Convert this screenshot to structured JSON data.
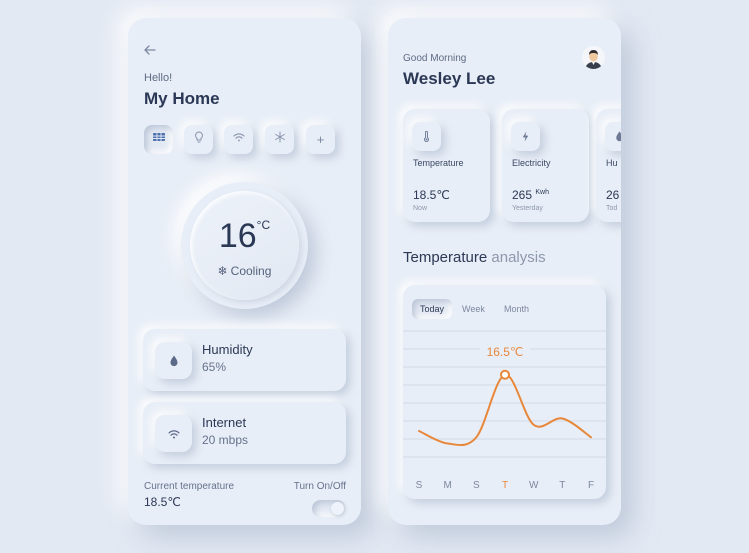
{
  "colors": {
    "background": "#e3e9f3",
    "accent": "#e8873a",
    "text_dark": "#2b3855",
    "text_muted": "#66738d"
  },
  "left": {
    "greeting": "Hello!",
    "title": "My Home",
    "device_buttons": [
      {
        "icon": "heater-icon"
      },
      {
        "icon": "lightbulb-icon"
      },
      {
        "icon": "wifi-icon"
      },
      {
        "icon": "fan-icon"
      },
      {
        "icon": "plus-icon",
        "label": "+"
      }
    ],
    "dial": {
      "temperature": "16",
      "unit": "°C",
      "mode": "Cooling",
      "mode_icon": "snowflake-icon"
    },
    "cards": [
      {
        "title": "Humidity",
        "value": "65%",
        "icon": "water-drop-icon"
      },
      {
        "title": "Internet",
        "value": "20 mbps",
        "icon": "wifi-icon"
      }
    ],
    "current_temperature_label": "Current temperature",
    "current_temperature_value": "18.5℃",
    "toggle_label": "Turn On/Off",
    "toggle_on": true
  },
  "right": {
    "greeting": "Good Morning",
    "user_name": "Wesley Lee",
    "stats": [
      {
        "label": "Temperature",
        "value": "18.5℃",
        "unit": "",
        "sub": "Now",
        "icon": "thermometer-icon"
      },
      {
        "label": "Electricity",
        "value": "265",
        "unit": "Kwh",
        "sub": "Yesterday",
        "icon": "lightning-icon"
      },
      {
        "label": "Hu",
        "value": "26",
        "unit": "",
        "sub": "Tod",
        "icon": "drop-icon"
      }
    ],
    "analysis_title_bold": "Temperature",
    "analysis_title_light": " analysis",
    "tabs": [
      "Today",
      "Week",
      "Month"
    ],
    "active_tab": "Today",
    "tooltip": "16.5℃"
  },
  "chart_data": {
    "type": "line",
    "categories": [
      "S",
      "M",
      "S",
      "T",
      "W",
      "T",
      "F"
    ],
    "highlight_category_index": 3,
    "series": [
      {
        "values": [
          12.0,
          11.0,
          11.5,
          16.5,
          12.5,
          13.0,
          11.5
        ]
      }
    ],
    "ylim": [
      8,
      20
    ],
    "grid": true,
    "line_color": "#e8873a",
    "title": "",
    "xlabel": "",
    "ylabel": ""
  }
}
